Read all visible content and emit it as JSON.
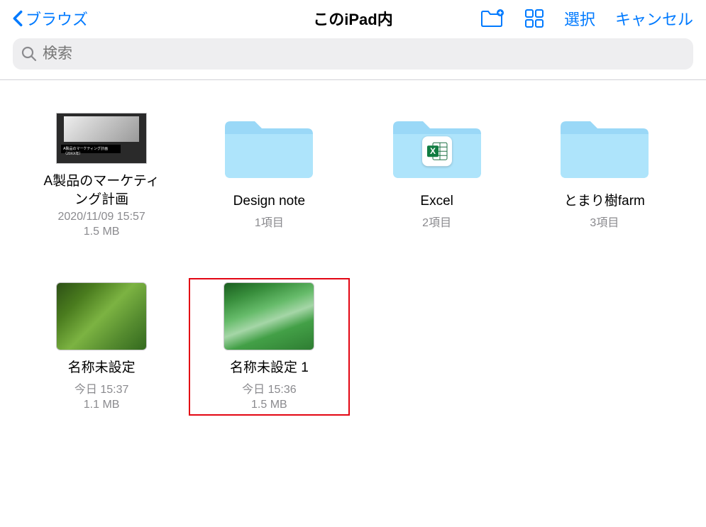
{
  "header": {
    "back_label": "ブラウズ",
    "title": "このiPad内",
    "select_label": "選択",
    "cancel_label": "キャンセル"
  },
  "search": {
    "placeholder": "検索"
  },
  "items": [
    {
      "name": "A製品のマーケティング計画",
      "meta1": "2020/11/09 15:57",
      "meta2": "1.5 MB",
      "type": "file",
      "thumb": "pptx"
    },
    {
      "name": "Design note",
      "meta1": "1項目",
      "type": "folder",
      "badge": null
    },
    {
      "name": "Excel",
      "meta1": "2項目",
      "type": "folder",
      "badge": "excel"
    },
    {
      "name": "とまり樹farm",
      "meta1": "3項目",
      "type": "folder",
      "badge": null
    },
    {
      "name": "名称未設定",
      "meta1": "今日 15:37",
      "meta2": "1.1 MB",
      "type": "image",
      "thumb": "plant1"
    },
    {
      "name": "名称未設定 1",
      "meta1": "今日 15:36",
      "meta2": "1.5 MB",
      "type": "image",
      "thumb": "plant2",
      "highlighted": true
    }
  ]
}
